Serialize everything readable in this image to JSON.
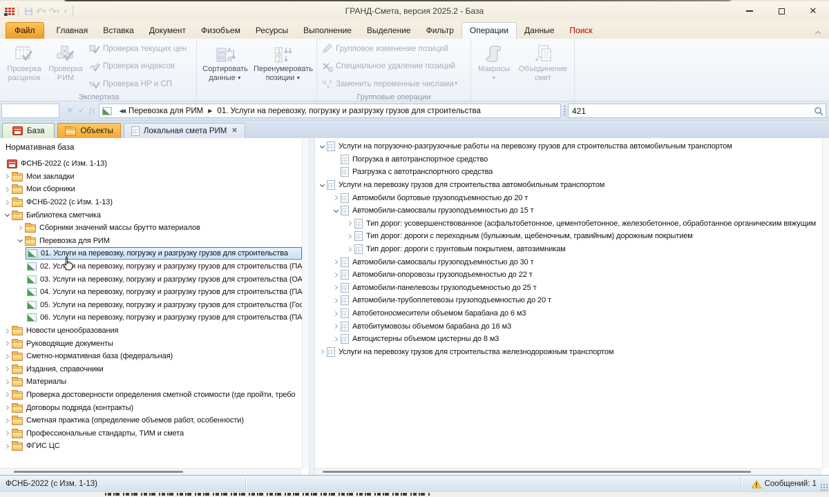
{
  "window": {
    "title": "ГРАНД-Смета, версия 2025.2 - База"
  },
  "menu_tabs": [
    {
      "label": "Файл",
      "kind": "file"
    },
    {
      "label": "Главная"
    },
    {
      "label": "Вставка"
    },
    {
      "label": "Документ"
    },
    {
      "label": "Физобъем"
    },
    {
      "label": "Ресурсы"
    },
    {
      "label": "Выполнение"
    },
    {
      "label": "Выделение"
    },
    {
      "label": "Фильтр"
    },
    {
      "label": "Операции",
      "active": true
    },
    {
      "label": "Данные"
    },
    {
      "label": "Поиск",
      "accent": true
    }
  ],
  "ribbon": {
    "groups": [
      {
        "label": "Экспертиза",
        "big": [
          {
            "lines": [
              "Проверка",
              "расценок"
            ],
            "disabled": true,
            "icon": "table-check"
          },
          {
            "lines": [
              "Проверка",
              "РИМ"
            ],
            "disabled": true,
            "icon": "diagram-check"
          }
        ],
        "small": [
          {
            "label": "Проверка текущих цен",
            "disabled": true,
            "icon": "box-check"
          },
          {
            "label": "Проверка индексов",
            "disabled": true,
            "icon": "chart-check"
          },
          {
            "label": "Проверка НР и СП",
            "disabled": true,
            "icon": "percent-check"
          }
        ]
      },
      {
        "label": "",
        "big": [
          {
            "lines": [
              "Сортировать",
              "данные"
            ],
            "dropdown": true,
            "icon": "sort-az"
          },
          {
            "lines": [
              "Перенумеровать",
              "позиции"
            ],
            "dropdown": true,
            "icon": "renumber"
          }
        ],
        "small": []
      },
      {
        "label": "Групповые операции",
        "big": [],
        "small": [
          {
            "label": "Групповое изменение позиций",
            "disabled": true,
            "icon": "pencil-edit"
          },
          {
            "label": "Специальное удаление позиций",
            "disabled": true,
            "icon": "delete-x"
          },
          {
            "label": "Заменить переменные числами",
            "disabled": true,
            "dropdown": true,
            "icon": "replace-numbers"
          }
        ]
      },
      {
        "label": "",
        "big": [
          {
            "lines": [
              "Макросы"
            ],
            "dropdown": true,
            "disabled": true,
            "icon": "macro-scroll"
          },
          {
            "lines": [
              "Объединение",
              "смет"
            ],
            "disabled": true,
            "icon": "merge-docs"
          }
        ],
        "small": []
      }
    ]
  },
  "formula_bar": {
    "name_box_value": "",
    "breadcrumbs": [
      "Перевозка для РИМ",
      "01. Услуги на перевозку, погрузку и разгрузку грузов для строительства"
    ],
    "search_value": "421"
  },
  "view_tabs": [
    {
      "label": "База",
      "kind": "base",
      "icon": "base-db"
    },
    {
      "label": "Объекты",
      "kind": "objects",
      "icon": "folder"
    },
    {
      "label": "Локальная смета РИМ",
      "kind": "document",
      "icon": "estimate-doc",
      "closable": true
    }
  ],
  "left_panel": {
    "header": "Нормативная база",
    "items": [
      {
        "text": "ФСНБ-2022 (с Изм. 1-13)",
        "level": 0,
        "icon": "database-red"
      },
      {
        "text": "Мои закладки",
        "level": 0,
        "icon": "folder",
        "arrow": "collapsed"
      },
      {
        "text": "Мои сборники",
        "level": 0,
        "icon": "folder",
        "arrow": "collapsed"
      },
      {
        "text": "ФСНБ-2022 (с Изм. 1-13)",
        "level": 0,
        "icon": "folder",
        "arrow": "collapsed"
      },
      {
        "text": "Библиотека сметчика",
        "level": 0,
        "icon": "folder",
        "arrow": "expanded"
      },
      {
        "text": "Сборники значений массы брутто материалов",
        "level": 1,
        "icon": "folder",
        "arrow": "collapsed"
      },
      {
        "text": "Перевозка для РИМ",
        "level": 1,
        "icon": "folder",
        "arrow": "expanded"
      },
      {
        "text": "01. Услуги на перевозку, погрузку и разгрузку грузов для строительства",
        "level": 2,
        "icon": "estimate-green",
        "selected": true
      },
      {
        "text": "02. Услуги на перевозку, погрузку и разгрузку грузов для строительства (ПА",
        "level": 2,
        "icon": "estimate-green"
      },
      {
        "text": "03. Услуги на перевозку, погрузку и разгрузку грузов для строительства (ОА",
        "level": 2,
        "icon": "estimate-green"
      },
      {
        "text": "04. Услуги на перевозку, погрузку и разгрузку грузов для строительства (ПА",
        "level": 2,
        "icon": "estimate-green"
      },
      {
        "text": "05. Услуги на перевозку, погрузку и разгрузку грузов для строительства (Гос",
        "level": 2,
        "icon": "estimate-green"
      },
      {
        "text": "06. Услуги на перевозку, погрузку и разгрузку грузов для строительства (ПА",
        "level": 2,
        "icon": "estimate-green"
      },
      {
        "text": "Новости ценообразования",
        "level": 0,
        "icon": "folder",
        "arrow": "collapsed"
      },
      {
        "text": "Руководящие документы",
        "level": 0,
        "icon": "folder",
        "arrow": "collapsed"
      },
      {
        "text": "Сметно-нормативная база (федеральная)",
        "level": 0,
        "icon": "folder",
        "arrow": "collapsed"
      },
      {
        "text": "Издания, справочники",
        "level": 0,
        "icon": "folder",
        "arrow": "collapsed"
      },
      {
        "text": "Материалы",
        "level": 0,
        "icon": "folder",
        "arrow": "collapsed"
      },
      {
        "text": "Проверка достоверности определения сметной стоимости (где пройти, требо",
        "level": 0,
        "icon": "folder",
        "arrow": "collapsed"
      },
      {
        "text": "Договоры подряда (контракты)",
        "level": 0,
        "icon": "folder",
        "arrow": "collapsed"
      },
      {
        "text": "Сметная практика (определение объемов работ, особенности)",
        "level": 0,
        "icon": "folder",
        "arrow": "collapsed"
      },
      {
        "text": "Профессиональные стандарты, ТИМ и смета",
        "level": 0,
        "icon": "folder",
        "arrow": "collapsed"
      },
      {
        "text": "ФГИС ЦС",
        "level": 0,
        "icon": "folder",
        "arrow": "collapsed"
      }
    ]
  },
  "right_panel": {
    "items": [
      {
        "text": "Услуги на погрузочно-разгрузочные работы на перевозку грузов для строительства автомобильным транспортом",
        "level": 0,
        "icon": "doc",
        "arrow": "expanded"
      },
      {
        "text": "Погрузка в автотранспортное средство",
        "level": 1,
        "icon": "doc"
      },
      {
        "text": "Разгрузка с автотранспортного средства",
        "level": 1,
        "icon": "doc"
      },
      {
        "text": "Услуги на перевозку грузов для строительства автомобильным транспортом",
        "level": 0,
        "icon": "doc",
        "arrow": "expanded"
      },
      {
        "text": "Автомобили бортовые грузоподъемностью до 20 т",
        "level": 1,
        "icon": "doc",
        "arrow": "collapsed"
      },
      {
        "text": "Автомобили-самосвалы грузоподъемностью до 15 т",
        "level": 1,
        "icon": "doc",
        "arrow": "expanded"
      },
      {
        "text": "Тип дорог: усовершенствованное (асфальтобетонное, цементобетонное, железобетонное, обработанное органическим вяжущим",
        "level": 2,
        "icon": "doc",
        "arrow": "collapsed"
      },
      {
        "text": "Тип дорог: дороги с переходным (булыжным, щебеночным, гравийным) дорожным покрытием",
        "level": 2,
        "icon": "doc",
        "arrow": "collapsed"
      },
      {
        "text": "Тип дорог: дороги с грунтовым покрытием, автозимникам",
        "level": 2,
        "icon": "doc",
        "arrow": "collapsed"
      },
      {
        "text": "Автомобили-самосвалы грузоподъемностью до 30 т",
        "level": 1,
        "icon": "doc",
        "arrow": "collapsed"
      },
      {
        "text": "Автомобили-опоровозы грузоподъемностью до 22 т",
        "level": 1,
        "icon": "doc",
        "arrow": "collapsed"
      },
      {
        "text": "Автомобили-панелевозы грузоподъемностью до 25 т",
        "level": 1,
        "icon": "doc",
        "arrow": "collapsed"
      },
      {
        "text": "Автомобили-трубоплетевозы грузоподъемностью до 20 т",
        "level": 1,
        "icon": "doc",
        "arrow": "collapsed"
      },
      {
        "text": "Автобетоносмесители объемом барабана до 6 м3",
        "level": 1,
        "icon": "doc",
        "arrow": "collapsed"
      },
      {
        "text": "Автобитумовозы объемом барабана до 16 м3",
        "level": 1,
        "icon": "doc",
        "arrow": "collapsed"
      },
      {
        "text": "Автоцистерны объемом цистерны до 8 м3",
        "level": 1,
        "icon": "doc",
        "arrow": "collapsed"
      },
      {
        "text": "Услуги на перевозку грузов для строительства железнодорожным транспортом",
        "level": 0,
        "icon": "doc",
        "arrow": "collapsed"
      }
    ]
  },
  "status_bar": {
    "left": "ФСНБ-2022 (с Изм. 1-13)",
    "messages": "Сообщений: 1"
  }
}
